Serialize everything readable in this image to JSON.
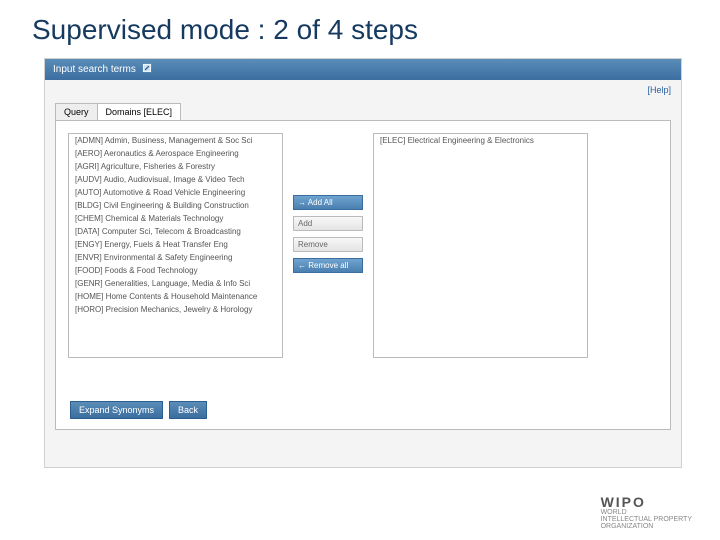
{
  "slide": {
    "title": "Supervised mode : 2 of 4 steps"
  },
  "titlebar": {
    "label": "Input search terms"
  },
  "help": {
    "label": "[Help]"
  },
  "tabs": {
    "query": "Query",
    "domains": "Domains [ELEC]"
  },
  "left_items": [
    {
      "label": "[ADMN] Admin, Business, Management & Soc Sci"
    },
    {
      "label": "[AERO] Aeronautics & Aerospace Engineering"
    },
    {
      "label": "[AGRI] Agriculture, Fisheries & Forestry"
    },
    {
      "label": "[AUDV] Audio, Audiovisual, Image & Video Tech"
    },
    {
      "label": "[AUTO] Automotive & Road Vehicle Engineering"
    },
    {
      "label": "[BLDG] Civil Engineering & Building Construction"
    },
    {
      "label": "[CHEM] Chemical & Materials Technology"
    },
    {
      "label": "[DATA] Computer Sci, Telecom & Broadcasting"
    },
    {
      "label": "[ENGY] Energy, Fuels & Heat Transfer Eng"
    },
    {
      "label": "[ENVR] Environmental & Safety Engineering"
    },
    {
      "label": "[FOOD] Foods & Food Technology"
    },
    {
      "label": "[GENR] Generalities, Language, Media & Info Sci"
    },
    {
      "label": "[HOME] Home Contents & Household Maintenance"
    },
    {
      "label": "[HORO] Precision Mechanics, Jewelry & Horology"
    }
  ],
  "right_items": [
    {
      "label": "[ELEC] Electrical Engineering & Electronics"
    }
  ],
  "mid": {
    "add_all": "→ Add All",
    "add": "Add",
    "remove": "Remove",
    "remove_all": "← Remove all"
  },
  "bottom": {
    "expand": "Expand Synonyms",
    "back": "Back"
  },
  "wipo": {
    "brand": "WIPO",
    "l1": "WORLD",
    "l2": "INTELLECTUAL PROPERTY",
    "l3": "ORGANIZATION"
  }
}
